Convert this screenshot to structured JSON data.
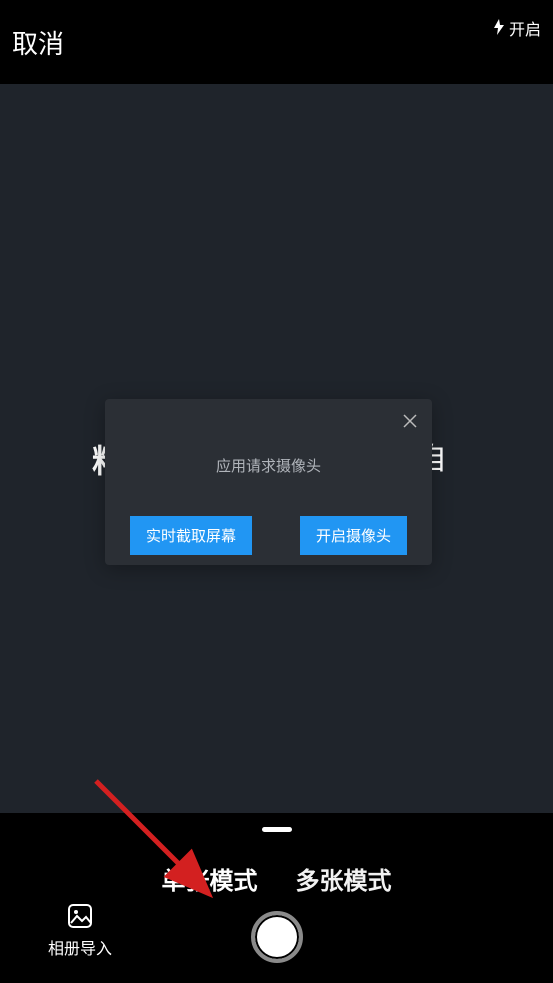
{
  "header": {
    "cancel_label": "取消",
    "flash_label": "开启"
  },
  "viewfinder": {
    "hint_fragment_left": "料",
    "hint_fragment_right": "自"
  },
  "dialog": {
    "title": "应用请求摄像头",
    "screenshot_btn": "实时截取屏幕",
    "camera_btn": "开启摄像头"
  },
  "bottom": {
    "mode_single": "单张模式",
    "mode_multi": "多张模式",
    "gallery_label": "相册导入"
  },
  "colors": {
    "primary_blue": "#2196f3",
    "viewfinder_bg": "#1f242b",
    "dialog_bg": "#2b2f35",
    "annotation_red": "#d32020"
  }
}
